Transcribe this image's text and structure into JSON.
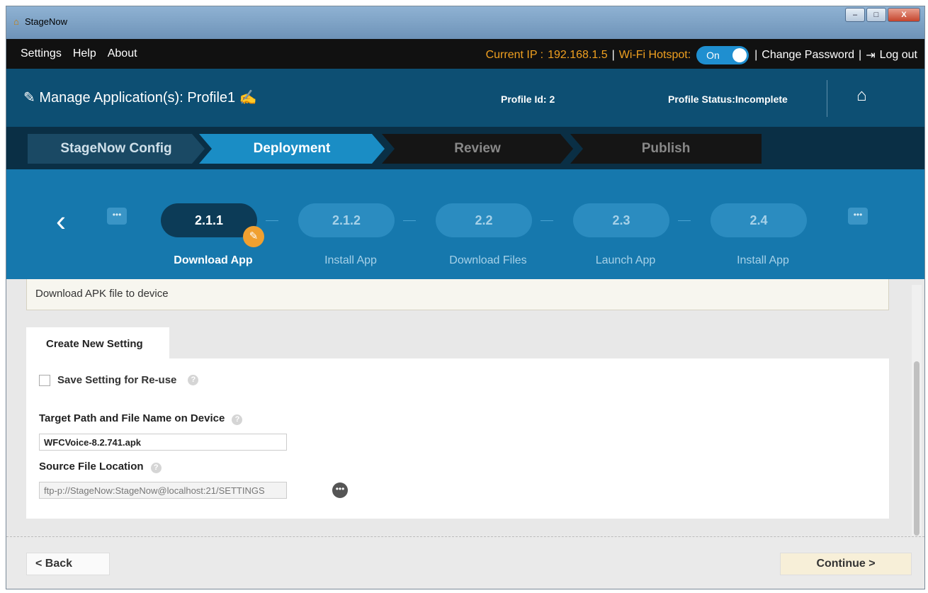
{
  "window": {
    "title": "StageNow",
    "min": "–",
    "max": "□",
    "close": "X"
  },
  "menubar": {
    "items": [
      "Settings",
      "Help",
      "About"
    ],
    "ip_label": "Current IP :",
    "ip_value": "192.168.1.5",
    "sep1": "|",
    "hotspot_label": "Wi-Fi Hotspot:",
    "hotspot_state": "On",
    "sep2": "|",
    "change_password": "Change Password",
    "sep3": "|",
    "logout": "Log out"
  },
  "profile": {
    "title": "Manage Application(s): Profile1",
    "profile_id": "Profile Id: 2",
    "profile_status": "Profile Status:Incomplete"
  },
  "steps": [
    "StageNow Config",
    "Deployment",
    "Review",
    "Publish"
  ],
  "substeps": [
    {
      "num": "2.1.1",
      "label": "Download App"
    },
    {
      "num": "2.1.2",
      "label": "Install App"
    },
    {
      "num": "2.2",
      "label": "Download Files"
    },
    {
      "num": "2.3",
      "label": "Launch App"
    },
    {
      "num": "2.4",
      "label": "Install App"
    }
  ],
  "more_label": "•••",
  "description": "Download APK file to device",
  "tab_label": "Create New Setting",
  "form": {
    "save_setting_label": "Save Setting for Re-use",
    "target_path_label": "Target Path and File Name on Device",
    "target_path_value": "WFCVoice-8.2.741.apk",
    "source_label": "Source File Location",
    "source_value": "ftp-p://StageNow:StageNow@localhost:21/SETTINGS",
    "browse_label": "•••",
    "help_glyph": "?"
  },
  "footer": {
    "back": "< Back",
    "continue": "Continue >"
  }
}
